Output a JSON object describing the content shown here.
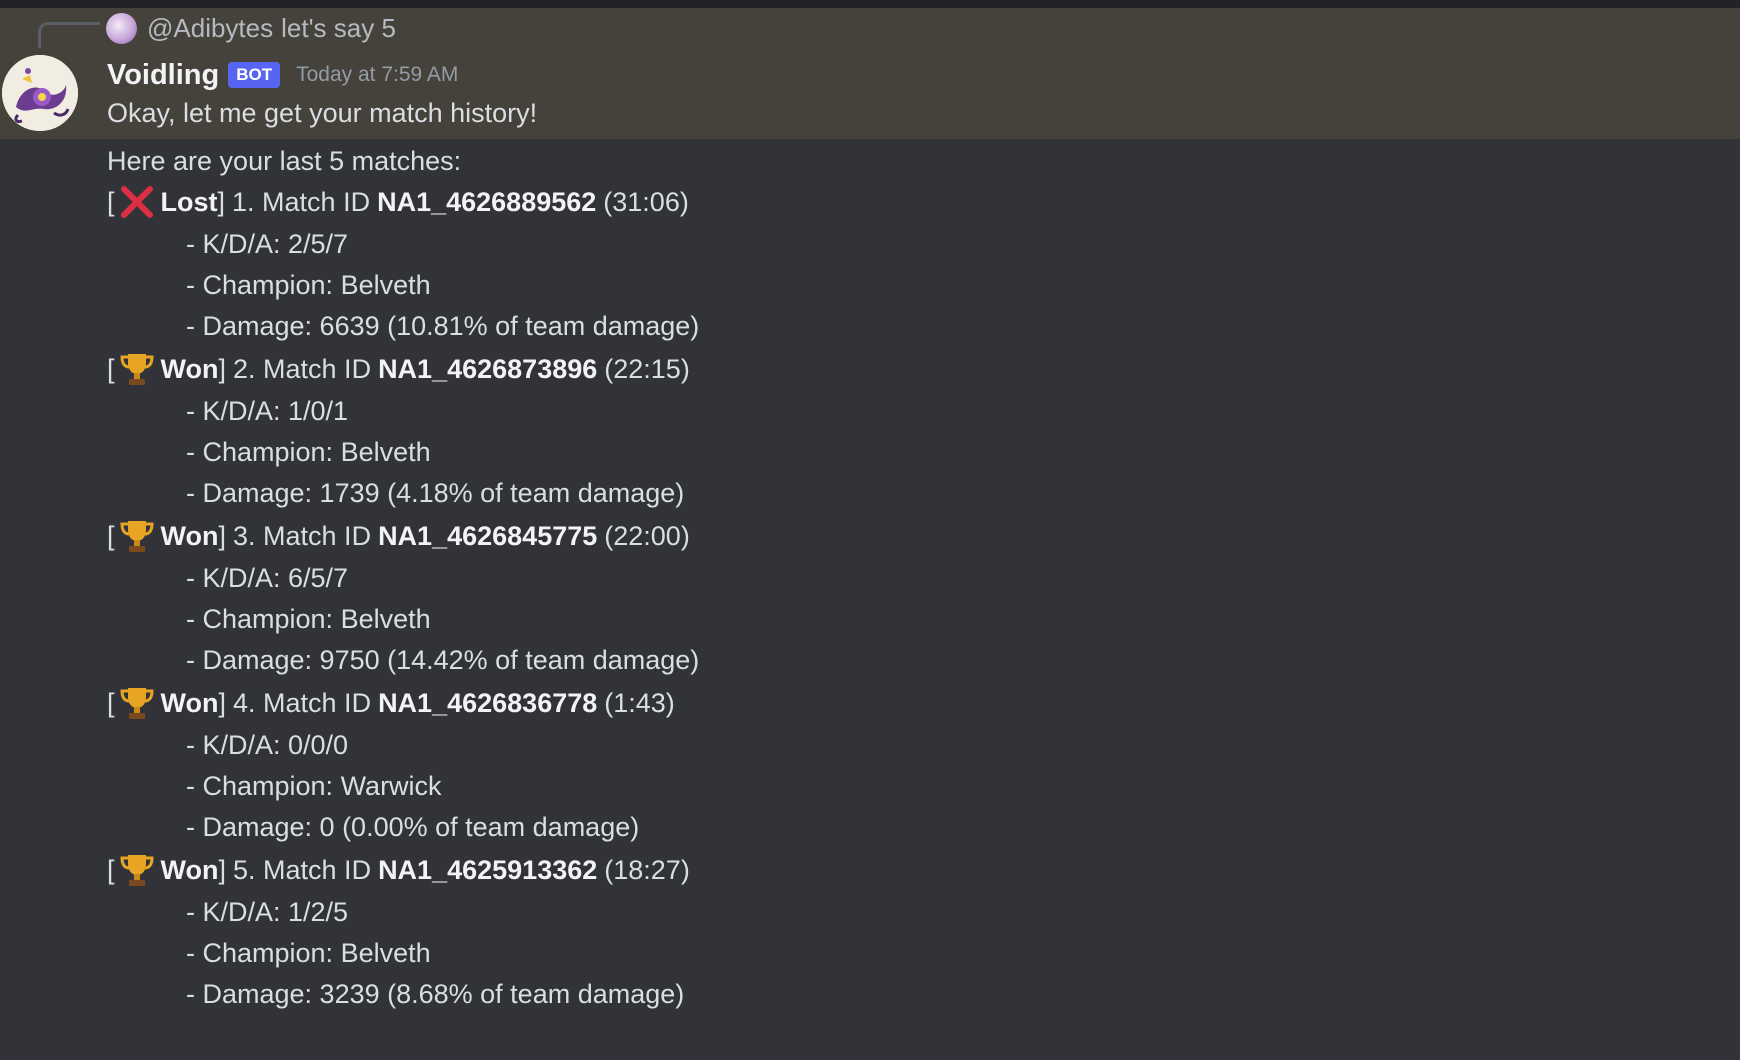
{
  "reply": {
    "author": "@Adibytes",
    "text": "let's say 5"
  },
  "message": {
    "username": "Voidling",
    "tag": "BOT",
    "timestamp": "Today at 7:59 AM",
    "line1": "Okay, let me get your match history!",
    "line2": "Here are your last 5 matches:"
  },
  "matches": [
    {
      "icon": "cross-mark-icon",
      "result": "Lost",
      "label": "1. Match ID",
      "id": "NA1_4626889562",
      "duration": "(31:06)",
      "kda": "- K/D/A: 2/5/7",
      "champion": "- Champion: Belveth",
      "damage": "- Damage: 6639 (10.81% of team damage)"
    },
    {
      "icon": "trophy-icon",
      "result": "Won",
      "label": "2. Match ID",
      "id": "NA1_4626873896",
      "duration": "(22:15)",
      "kda": "- K/D/A: 1/0/1",
      "champion": "- Champion: Belveth",
      "damage": "- Damage: 1739 (4.18% of team damage)"
    },
    {
      "icon": "trophy-icon",
      "result": "Won",
      "label": "3. Match ID",
      "id": "NA1_4626845775",
      "duration": "(22:00)",
      "kda": "- K/D/A: 6/5/7",
      "champion": "- Champion: Belveth",
      "damage": "- Damage: 9750 (14.42% of team damage)"
    },
    {
      "icon": "trophy-icon",
      "result": "Won",
      "label": "4. Match ID",
      "id": "NA1_4626836778",
      "duration": "(1:43)",
      "kda": "- K/D/A: 0/0/0",
      "champion": "- Champion: Warwick",
      "damage": "- Damage: 0 (0.00% of team damage)"
    },
    {
      "icon": "trophy-icon",
      "result": "Won",
      "label": "5. Match ID",
      "id": "NA1_4625913362",
      "duration": "(18:27)",
      "kda": "- K/D/A: 1/2/5",
      "champion": "- Champion: Belveth",
      "damage": "- Damage: 3239 (8.68% of team damage)"
    }
  ],
  "colors": {
    "background": "#313338",
    "highlight": "#44423a",
    "bot_tag": "#5865f2",
    "lost_icon": "#dd2e44",
    "trophy_icon": "#e8a523"
  }
}
